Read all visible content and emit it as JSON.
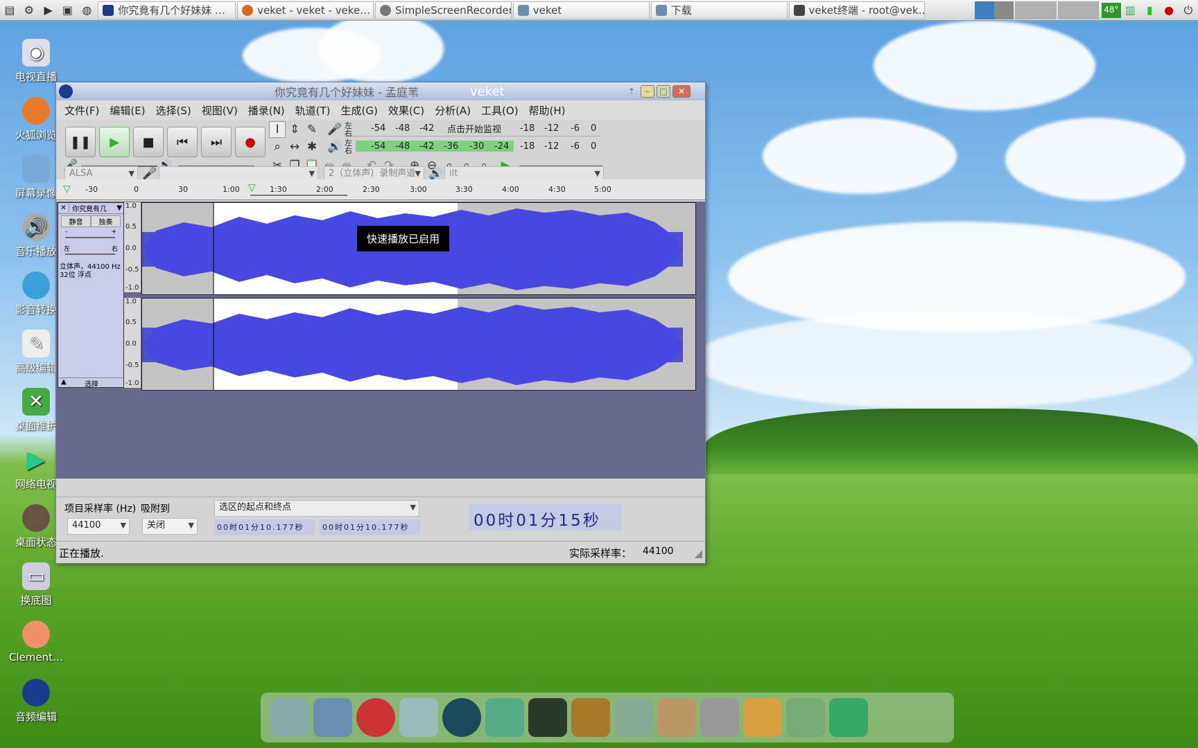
{
  "taskbar": {
    "tasks": [
      {
        "label": "你究竟有几个好妹妹 …",
        "color": "#1a3b8c"
      },
      {
        "label": "veket - veket - veke…",
        "color": "#d46a1e"
      },
      {
        "label": "SimpleScreenRecorder",
        "color": "#777777"
      },
      {
        "label": "veket",
        "color": "#6a8fb0"
      },
      {
        "label": "下载",
        "color": "#6a8fb0"
      },
      {
        "label": "veket终端 - root@vek…",
        "color": "#444444"
      }
    ],
    "tray_temp": "48°"
  },
  "desktop_icons": [
    "电视直播",
    "火狐浏览",
    "屏幕录像",
    "音乐播放",
    "影音转换",
    "高级编辑",
    "桌面维护",
    "网络电视",
    "桌面状态",
    "换底图",
    "Clement…",
    "音频编辑"
  ],
  "window": {
    "title": "你究竟有几个好妹妹 - 孟庭苇",
    "subtitle": "veket",
    "menu": [
      "文件(F)",
      "编辑(E)",
      "选择(S)",
      "视图(V)",
      "播录(N)",
      "轨道(T)",
      "生成(G)",
      "效果(C)",
      "分析(A)",
      "工具(O)",
      "帮助(H)"
    ],
    "meter_record_scale": [
      "-54",
      "-48",
      "-42",
      "点击开始监视",
      "-18",
      "-12",
      "-6",
      "0"
    ],
    "meter_play_scale": [
      "-54",
      "-48",
      "-42",
      "-36",
      "-30",
      "-24",
      "-18",
      "-12",
      "-6",
      "0"
    ],
    "meter_lr": [
      "左",
      "右"
    ],
    "device_host": "ALSA",
    "record_channels": "2（立体声）录制声道",
    "output_device": "ilt",
    "ruler_ticks": [
      "-30",
      "0",
      "30",
      "1:00",
      "1:30",
      "2:00",
      "2:30",
      "3:00",
      "3:30",
      "4:00",
      "4:30",
      "5:00"
    ],
    "track": {
      "name": "你究竟有几",
      "mute": "静音",
      "solo": "独奏",
      "pan_left": "左",
      "pan_right": "右",
      "gain_minus": "-",
      "gain_plus": "+",
      "info": "立体声，44100 Hz 32位 浮点",
      "select": "选择",
      "scale": [
        "1.0",
        "0.5",
        "0.0",
        "-0.5",
        "-1.0"
      ]
    },
    "tooltip": "快速播放已启用",
    "selection": {
      "rate_label": "项目采样率 (Hz)",
      "rate_value": "44100",
      "snap_label": "吸附到",
      "snap_value": "关闭",
      "mode": "选区的起点和终点",
      "start": "00时01分10.177秒",
      "end": "00时01分10.177秒",
      "position": "00时01分15秒"
    },
    "status": {
      "left": "正在播放.",
      "rate_label": "实际采样率：",
      "rate_value": "44100"
    }
  }
}
